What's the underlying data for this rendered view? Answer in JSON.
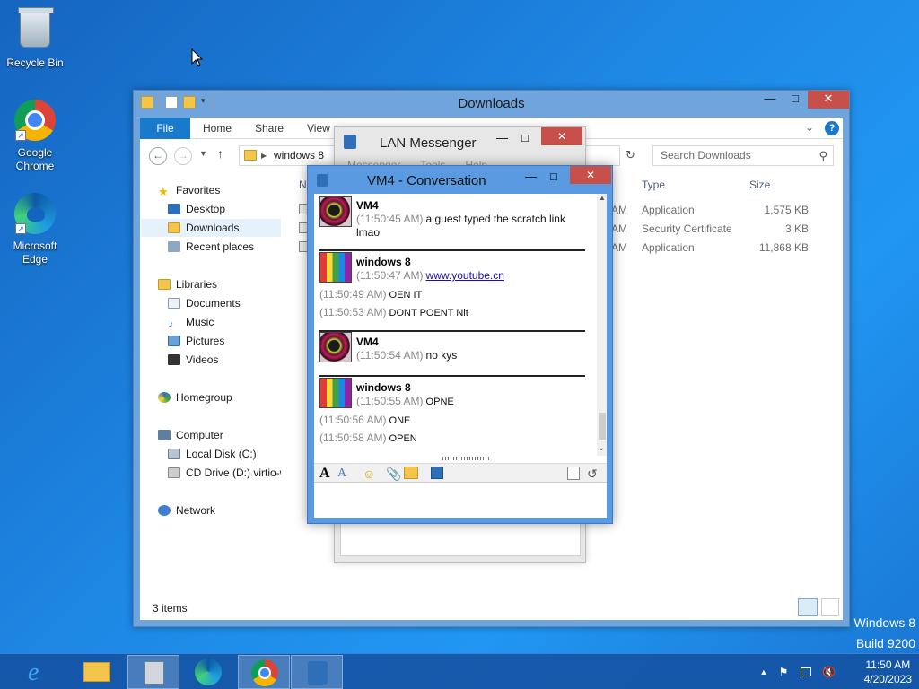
{
  "desktop": {
    "icons": [
      {
        "label": "Recycle Bin"
      },
      {
        "label": "Google Chrome"
      },
      {
        "label": "Microsoft Edge"
      }
    ],
    "watermark": {
      "line1": "Windows 8",
      "line2": "Build 9200"
    }
  },
  "explorer": {
    "title": "Downloads",
    "tabs": [
      "File",
      "Home",
      "Share",
      "View"
    ],
    "address": "windows 8",
    "search_placeholder": "Search Downloads",
    "nav": {
      "favorites": "Favorites",
      "desktop": "Desktop",
      "downloads": "Downloads",
      "recent": "Recent places",
      "libraries": "Libraries",
      "documents": "Documents",
      "music": "Music",
      "pictures": "Pictures",
      "videos": "Videos",
      "homegroup": "Homegroup",
      "computer": "Computer",
      "local_disk": "Local Disk (C:)",
      "cd_drive": "CD Drive (D:) virtio-w",
      "network": "Network"
    },
    "columns": {
      "name": "N",
      "type": "Type",
      "size": "Size"
    },
    "files": [
      {
        "time_tail": "AM",
        "type": "Application",
        "size": "1,575 KB"
      },
      {
        "time_tail": "AM",
        "type": "Security Certificate",
        "size": "3 KB"
      },
      {
        "time_tail": "AM",
        "type": "Application",
        "size": "11,868 KB"
      }
    ],
    "status": "3 items"
  },
  "lan_messenger": {
    "title": "LAN Messenger",
    "menu": [
      "Messenger",
      "Tools",
      "Help"
    ]
  },
  "conversation": {
    "title": "VM4 - Conversation",
    "messages": [
      {
        "sender": "VM4",
        "lines": [
          {
            "time": "(11:50:45 AM)",
            "text": "a guest typed the scratch link"
          },
          {
            "time": "",
            "text": "lmao"
          }
        ]
      },
      {
        "sender": "windows 8",
        "lines": [
          {
            "time": "(11:50:47 AM)",
            "text": "www.youtube.cn"
          },
          {
            "time": "(11:50:49 AM)",
            "text": "OEN IT"
          },
          {
            "time": "(11:50:53 AM)",
            "text": "DONT POENT Nit"
          }
        ]
      },
      {
        "sender": "VM4",
        "lines": [
          {
            "time": "(11:50:54 AM)",
            "text": "no kys"
          }
        ]
      },
      {
        "sender": "windows 8",
        "lines": [
          {
            "time": "(11:50:55 AM)",
            "text": "OPNE"
          },
          {
            "time": "(11:50:56 AM)",
            "text": "ONE"
          },
          {
            "time": "(11:50:58 AM)",
            "text": "OPEN"
          }
        ]
      }
    ]
  },
  "taskbar": {
    "time": "11:50 AM",
    "date": "4/20/2023"
  }
}
